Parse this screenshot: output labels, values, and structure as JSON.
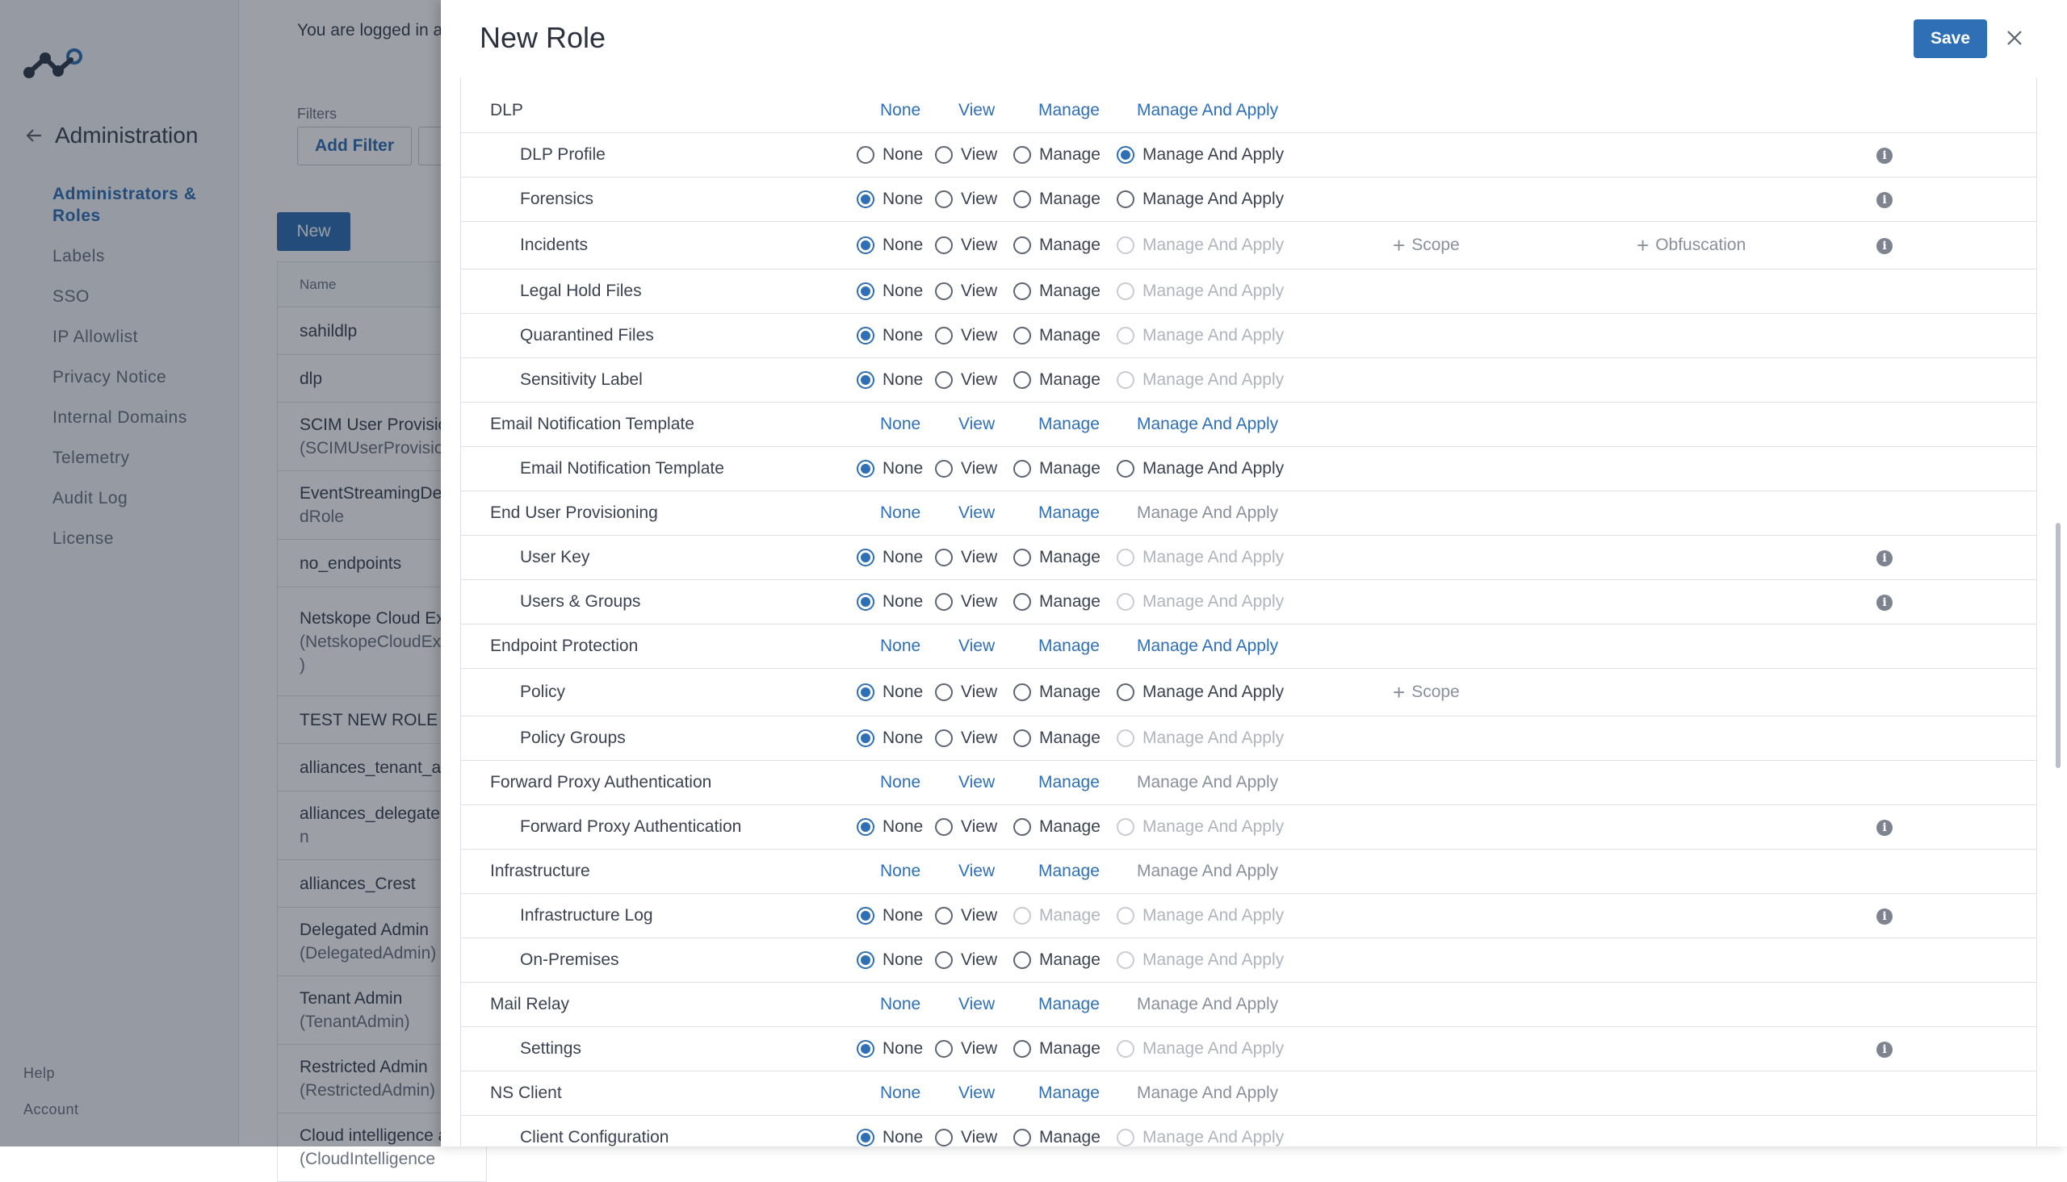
{
  "sidebar": {
    "title": "Administration",
    "nav_items": [
      {
        "label": "Administrators & Roles",
        "active": true
      },
      {
        "label": "Labels"
      },
      {
        "label": "SSO"
      },
      {
        "label": "IP Allowlist"
      },
      {
        "label": "Privacy Notice"
      },
      {
        "label": "Internal Domains"
      },
      {
        "label": "Telemetry"
      },
      {
        "label": "Audit Log"
      },
      {
        "label": "License"
      }
    ],
    "footer": {
      "help": "Help",
      "account": "Account"
    }
  },
  "main": {
    "logged_in_text": "You are logged in as",
    "filters_label": "Filters",
    "add_filter_label": "Add Filter",
    "new_button_label": "New",
    "table_header_name": "Name",
    "roles": [
      {
        "name": "sahildlp"
      },
      {
        "name": "dlp"
      },
      {
        "name": "SCIM User Provisic",
        "sub": "(SCIMUserProvisio"
      },
      {
        "name": "EventStreamingDe",
        "sub": "dRole"
      },
      {
        "name": "no_endpoints"
      },
      {
        "name": "Netskope Cloud Ex",
        "sub": "(NetskopeCloudEx",
        "sub2": ")"
      },
      {
        "name": "TEST NEW ROLE"
      },
      {
        "name": "alliances_tenant_ac"
      },
      {
        "name": "alliances_delegatec",
        "sub": "n"
      },
      {
        "name": "alliances_Crest"
      },
      {
        "name": "Delegated Admin",
        "sub": "(DelegatedAdmin)"
      },
      {
        "name": "Tenant Admin",
        "sub": "(TenantAdmin)"
      },
      {
        "name": "Restricted Admin",
        "sub": "(RestrictedAdmin)"
      },
      {
        "name": "Cloud intelligence a",
        "sub": "(CloudIntelligence"
      }
    ]
  },
  "panel": {
    "title": "New Role",
    "save_label": "Save",
    "option_labels": {
      "none": "None",
      "view": "View",
      "manage": "Manage",
      "manage_apply": "Manage And Apply"
    },
    "extra_labels": {
      "scope": "Scope",
      "obfuscation": "Obfuscation"
    },
    "accent_color": "#2f6fb5",
    "rows": [
      {
        "type": "group",
        "label": "DLP"
      },
      {
        "type": "child",
        "label": "DLP Profile",
        "selected": "manage_apply",
        "info": true
      },
      {
        "type": "child",
        "label": "Forensics",
        "selected": "none",
        "info": true
      },
      {
        "type": "child",
        "label": "Incidents",
        "selected": "none",
        "disabled": [
          "manage_apply"
        ],
        "scope": true,
        "obfuscation": true,
        "info": true
      },
      {
        "type": "child",
        "label": "Legal Hold Files",
        "selected": "none",
        "disabled": [
          "manage_apply"
        ]
      },
      {
        "type": "child",
        "label": "Quarantined Files",
        "selected": "none",
        "disabled": [
          "manage_apply"
        ]
      },
      {
        "type": "child",
        "label": "Sensitivity Label",
        "selected": "none",
        "disabled": [
          "manage_apply"
        ]
      },
      {
        "type": "group",
        "label": "Email Notification Template"
      },
      {
        "type": "child",
        "label": "Email Notification Template",
        "selected": "none"
      },
      {
        "type": "group",
        "label": "End User Provisioning",
        "muted_apply": true
      },
      {
        "type": "child",
        "label": "User Key",
        "selected": "none",
        "disabled": [
          "manage_apply"
        ],
        "info": true
      },
      {
        "type": "child",
        "label": "Users & Groups",
        "selected": "none",
        "disabled": [
          "manage_apply"
        ],
        "info": true
      },
      {
        "type": "group",
        "label": "Endpoint Protection"
      },
      {
        "type": "child",
        "label": "Policy",
        "selected": "none",
        "scope": true
      },
      {
        "type": "child",
        "label": "Policy Groups",
        "selected": "none",
        "disabled": [
          "manage_apply"
        ]
      },
      {
        "type": "group",
        "label": "Forward Proxy Authentication",
        "muted_apply": true
      },
      {
        "type": "child",
        "label": "Forward Proxy Authentication",
        "selected": "none",
        "disabled": [
          "manage_apply"
        ],
        "info": true
      },
      {
        "type": "group",
        "label": "Infrastructure",
        "muted_apply": true
      },
      {
        "type": "child",
        "label": "Infrastructure Log",
        "selected": "none",
        "disabled": [
          "manage",
          "manage_apply"
        ],
        "info": true
      },
      {
        "type": "child",
        "label": "On-Premises",
        "selected": "none",
        "disabled": [
          "manage_apply"
        ]
      },
      {
        "type": "group",
        "label": "Mail Relay",
        "muted_apply": true
      },
      {
        "type": "child",
        "label": "Settings",
        "selected": "none",
        "disabled": [
          "manage_apply"
        ],
        "info": true
      },
      {
        "type": "group",
        "label": "NS Client",
        "muted_apply": true
      },
      {
        "type": "child",
        "label": "Client Configuration",
        "selected": "none",
        "disabled": [
          "manage_apply"
        ]
      }
    ]
  }
}
